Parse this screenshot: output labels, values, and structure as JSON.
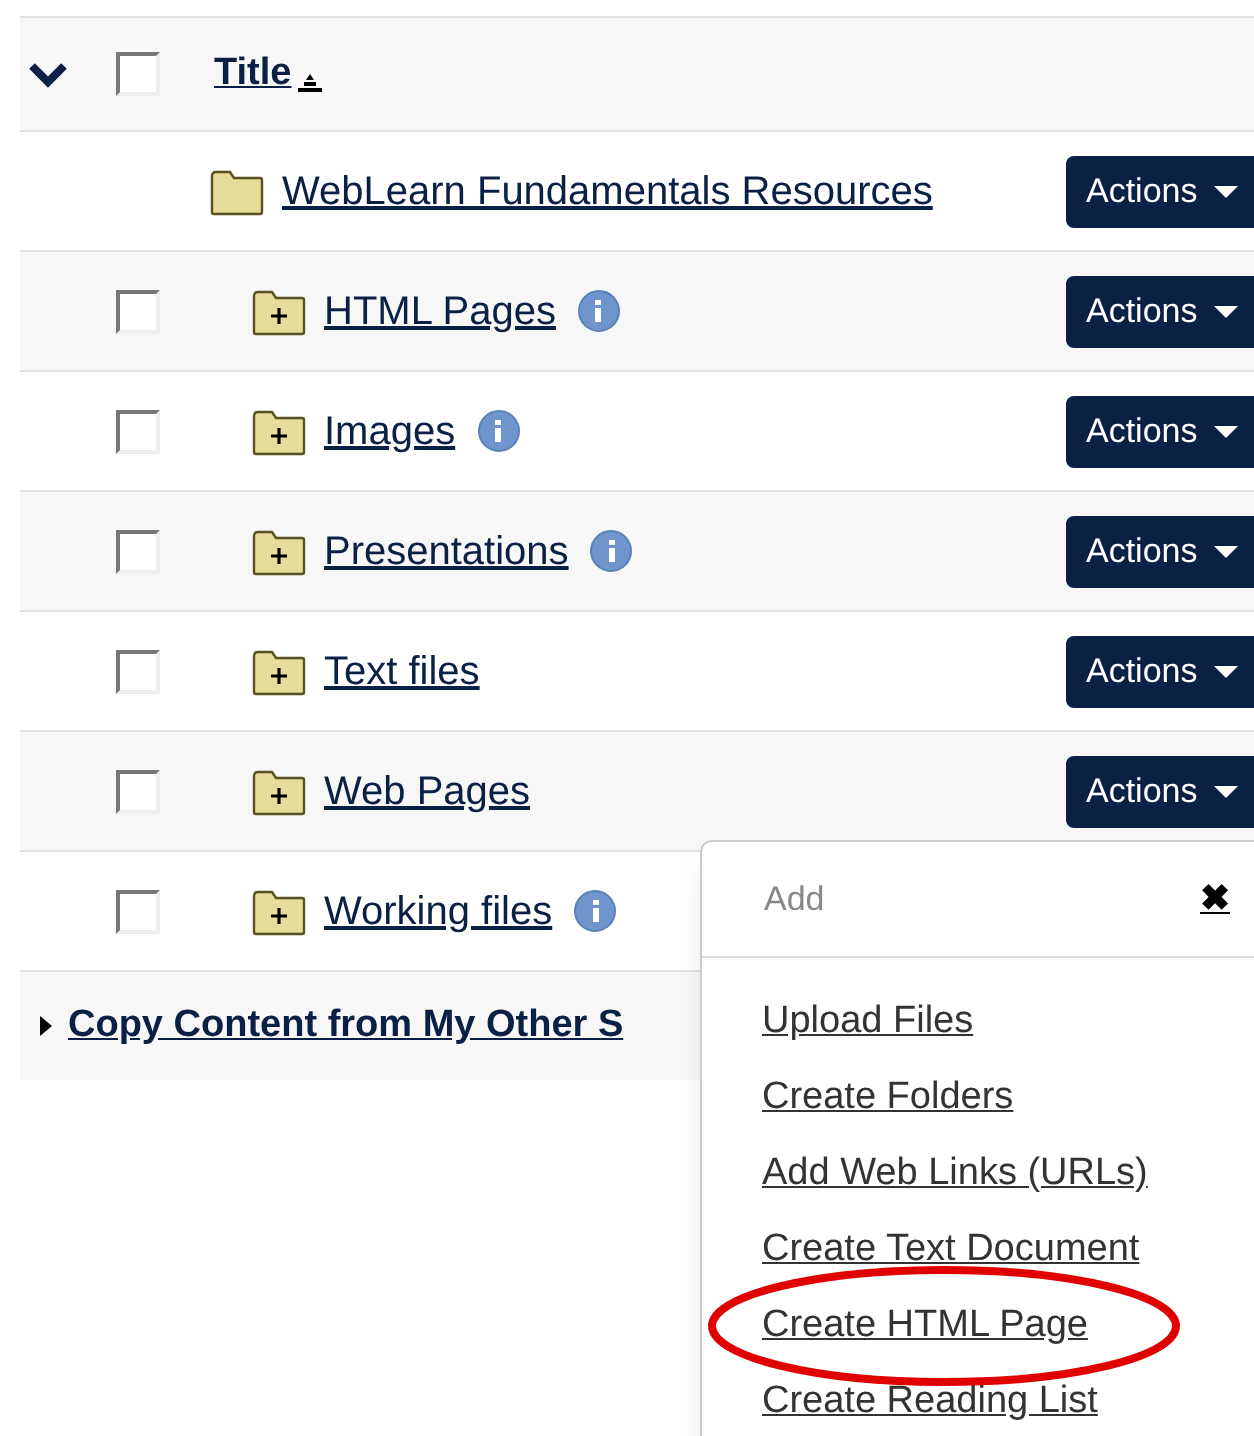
{
  "table": {
    "header": {
      "expanded": true,
      "checked": false,
      "title": "Title",
      "sort_ascending": true
    },
    "rows": [
      {
        "title": "WebLearn Fundamentals Resources",
        "kind": "root",
        "action": "Actions",
        "children": [
          {
            "title": "HTML Pages",
            "kind": "folder",
            "checked": false,
            "info": true,
            "action": "Actions"
          },
          {
            "title": "Images",
            "kind": "folder",
            "checked": false,
            "info": true,
            "action": "Actions"
          },
          {
            "title": "Presentations",
            "kind": "folder",
            "checked": false,
            "info": true,
            "action": "Actions"
          },
          {
            "title": "Text files",
            "kind": "folder",
            "checked": false,
            "info": false,
            "action": "Actions"
          },
          {
            "title": "Web Pages",
            "kind": "folder",
            "checked": false,
            "info": false,
            "action": "Actions"
          },
          {
            "title": "Working files",
            "kind": "folder",
            "checked": false,
            "info": true
          }
        ]
      }
    ],
    "footer": {
      "label": "Copy Content from My Other S",
      "expanded": false
    }
  },
  "menu": {
    "title": "Add",
    "close": "✖",
    "items": [
      {
        "label": "Upload Files",
        "highlighted": false
      },
      {
        "label": "Create Folders",
        "highlighted": false
      },
      {
        "label": "Add Web Links (URLs)",
        "highlighted": false
      },
      {
        "label": "Create Text Document",
        "highlighted": false
      },
      {
        "label": "Create HTML Page",
        "highlighted": true
      },
      {
        "label": "Create Reading List",
        "highlighted": false
      }
    ]
  }
}
